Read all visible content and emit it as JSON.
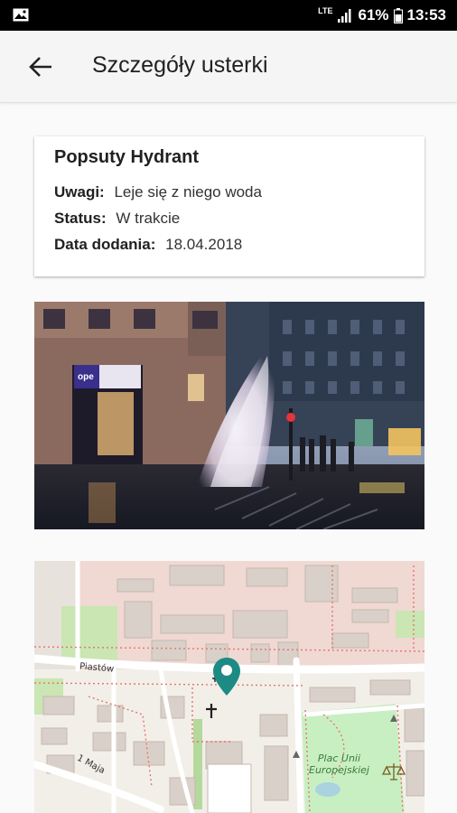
{
  "status_bar": {
    "network": "LTE",
    "battery": "61%",
    "time": "13:53",
    "icons": [
      "image-icon",
      "signal-icon",
      "battery-icon"
    ]
  },
  "app_bar": {
    "title": "Szczegóły usterki",
    "back_icon": "arrow-back-icon"
  },
  "issue": {
    "name": "Popsuty Hydrant",
    "notes_label": "Uwagi:",
    "notes_value": "Leje się z niego woda",
    "status_label": "Status:",
    "status_value": "W trakcie",
    "date_label": "Data dodania:",
    "date_value": "18.04.2018"
  },
  "photo": {
    "shop_sign": "ope"
  },
  "map": {
    "street_piastow": "Piastów",
    "street_1maja": "1 Maja",
    "park_line1": "Plac Unii",
    "park_line2": "Europejskiej",
    "marker_icon": "location-pin-icon",
    "marker_color": "#1e8a84"
  }
}
